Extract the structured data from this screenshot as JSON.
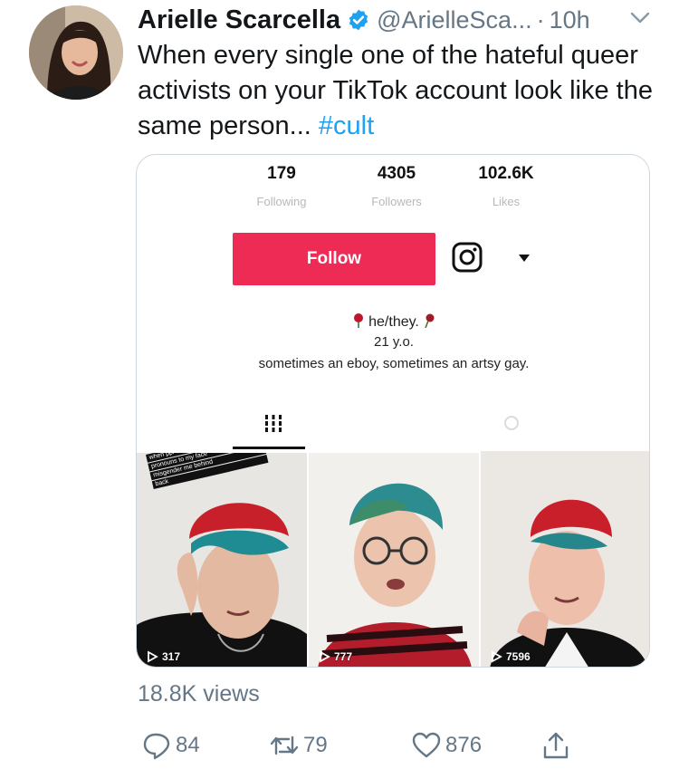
{
  "tweet": {
    "display_name": "Arielle Scarcella",
    "handle": "@ArielleSca...",
    "separator": "·",
    "time": "10h",
    "text": "When every single one of the hateful queer activists on your TikTok account look like the same person... ",
    "hashtag": "#cult",
    "views": "18.8K views"
  },
  "tiktok": {
    "stats": {
      "following_count": "179",
      "following_label": "Following",
      "followers_count": "4305",
      "followers_label": "Followers",
      "likes_count": "102.6K",
      "likes_label": "Likes"
    },
    "follow_label": "Follow",
    "bio_line1": "he/they.",
    "bio_line2": "21 y.o.",
    "bio_line3": "sometimes an eboy, sometimes an artsy gay.",
    "overlay_lines": [
      "when ppl use the right",
      "pronouns to my face",
      "misgender me behind",
      "back"
    ],
    "videos": [
      {
        "views": "317"
      },
      {
        "views": "777"
      },
      {
        "views": "7596"
      }
    ]
  },
  "actions": {
    "replies": "84",
    "retweets": "79",
    "likes": "876"
  },
  "colors": {
    "link": "#1da1f2",
    "muted": "#657786",
    "tiktok_follow": "#ee2b55"
  }
}
